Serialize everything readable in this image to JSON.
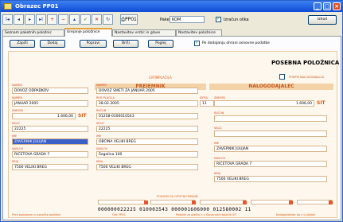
{
  "window": {
    "title": "Obrazec PP01"
  },
  "toolbar": {
    "nav_buttons": [
      {
        "name": "first",
        "label": "I◂"
      },
      {
        "name": "prev",
        "label": "◂"
      },
      {
        "name": "next",
        "label": "▸"
      },
      {
        "name": "last",
        "label": "▸I"
      },
      {
        "name": "add",
        "label": "+"
      },
      {
        "name": "delete",
        "label": "−"
      },
      {
        "name": "up",
        "label": "▴"
      },
      {
        "name": "accept",
        "label": "✓"
      },
      {
        "name": "cancel",
        "label": "✕"
      },
      {
        "name": "refresh",
        "label": "↻"
      }
    ],
    "print_label": "PP01",
    "paket_label": "Paket",
    "paket_value": "KOM",
    "izracun_label": "Izračun olika",
    "izhod_label": "Izhod"
  },
  "tabs": [
    "Seznam paketnih položnic",
    "Urejanje položnice",
    "Nastavitev vrstic in glave",
    "Nastavitev položnice"
  ],
  "panel": {
    "buttons": [
      "Zapiši",
      "Dodaj",
      "Popravi",
      "Briši",
      "Poglej"
    ],
    "checkbox_label": "Po dodajanju ohrani osnovne podatke"
  },
  "form": {
    "title": "POSEBNA POLOŽNICA",
    "subtitle": "CATIMPLAČILA",
    "corner_label": "PODPIS NALOGODAJALCA",
    "payer_header": "PREJEMNIK",
    "recipient_header": "NALOGODAJALEC",
    "fields_left": [
      {
        "label": "NAMEN",
        "value": "DOVOZ ODPADKOV"
      },
      {
        "label": "NAMEN",
        "value": "JANUAR 2005"
      },
      {
        "label": "ZNESEK",
        "value": "1.606,00",
        "currency": "SIT"
      },
      {
        "label": "SKLIC",
        "value": "22225"
      },
      {
        "label": "IME",
        "value": "ZAVERNIK JULIJAN"
      },
      {
        "label": "NASLOV",
        "value": "RIČETOVA GRADA 7"
      },
      {
        "label": "KRAJ",
        "value": "7500 VELIKI BREG"
      }
    ],
    "fields_mid": [
      {
        "label": "NAMEN",
        "value": "DOVOZ SMETI ZA JANUAR 2005"
      },
      {
        "label": "ROK PLAČILA",
        "value": "28.02.2005"
      },
      {
        "label": "RAČUN",
        "value": "01258-0100010543"
      },
      {
        "label": "SKLIC",
        "value": "22225"
      },
      {
        "label": "IME",
        "value": "OBČINA VELIKI BREG"
      },
      {
        "label": "NASLOV",
        "value": "Šegolina 100"
      },
      {
        "label": "KRAJ",
        "value": "7500 VELIKI BREG"
      }
    ],
    "sifra_label": "ŠIFRA",
    "sifra_value": "11",
    "fields_right": [
      {
        "label": "ZNESEK",
        "value": "1.606,00",
        "currency": "SIT"
      },
      {
        "label": "RAČUN",
        "value": ""
      },
      {
        "label": "SKLIC",
        "value": ""
      },
      {
        "label": "IME",
        "value": "ZAVERNIK JULIJAN"
      },
      {
        "label": "NASLOV",
        "value": "RIČETOVA GRADA 7"
      },
      {
        "label": "KRAJ",
        "value": "7500 VELIKI BREG"
      }
    ],
    "bottom_label": "PODATKI ZA OPTIČNO BRANJE",
    "ocr_line": "000000022225 010003543 000001606000 012580002 11",
    "footer": [
      "Pred podpisom si oznočite podatke",
      "Obr. PP01",
      "Podatki za plačilo k v Slovenskih tolarjih SIT",
      "Nalogodajalec ba v Ljubljani"
    ]
  }
}
